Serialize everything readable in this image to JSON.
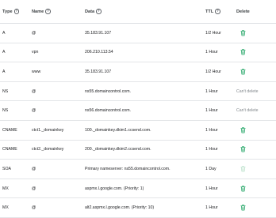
{
  "header": {
    "type": "Type",
    "name": "Name",
    "data": "Data",
    "ttl": "TTL",
    "delete": "Delete"
  },
  "colors": {
    "delete_icon": "#0f9d58",
    "delete_icon_disabled": "#b7dfc8",
    "muted_text": "#80868b"
  },
  "records": [
    {
      "type": "A",
      "name": "@",
      "data": "35.183.91.107",
      "ttl": "1/2 Hour",
      "delete": "trash-icon"
    },
    {
      "type": "A",
      "name": "vpn",
      "data": "206.210.113.54",
      "ttl": "1 Hour",
      "delete": "trash-icon"
    },
    {
      "type": "A",
      "name": "www",
      "data": "35.183.91.107",
      "ttl": "1/2 Hour",
      "delete": "trash-icon"
    },
    {
      "type": "NS",
      "name": "@",
      "data": "ns55.domaincontrol.com.",
      "ttl": "1 Hour",
      "delete": "Can't delete"
    },
    {
      "type": "NS",
      "name": "@",
      "data": "ns56.domaincontrol.com.",
      "ttl": "1 Hour",
      "delete": "Can't delete"
    },
    {
      "type": "CNAME",
      "name": "ctct1._domainkey",
      "data": "100._domainkey.dkim1.ccsend.com.",
      "ttl": "1 Hour",
      "delete": "trash-icon"
    },
    {
      "type": "CNAME",
      "name": "ctct2._domainkey",
      "data": "200._domainkey.dkim2.ccsend.com.",
      "ttl": "1 Hour",
      "delete": "trash-icon"
    },
    {
      "type": "SOA",
      "name": "@",
      "data": "Primary nameserver: ns55.domaincontrol.com.",
      "ttl": "1 Day",
      "delete": "trash-icon-disabled"
    },
    {
      "type": "MX",
      "name": "@",
      "data": "aspmx.l.google.com. (Priority: 1)",
      "ttl": "1 Hour",
      "delete": "trash-icon"
    },
    {
      "type": "MX",
      "name": "@",
      "data": "alt2.aspmx.l.google.com. (Priority: 10)",
      "ttl": "1 Hour",
      "delete": "trash-icon"
    }
  ]
}
